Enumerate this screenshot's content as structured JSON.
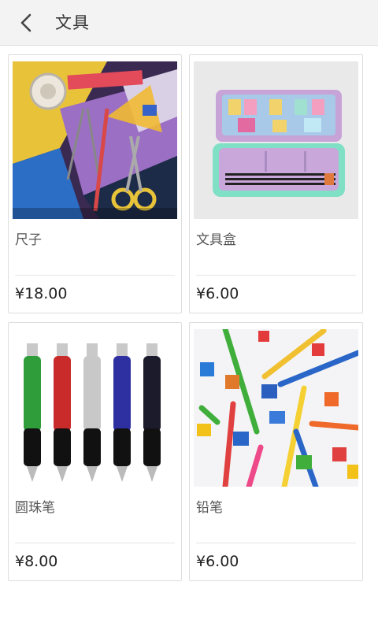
{
  "header": {
    "back_icon": "chevron-left-icon",
    "title": "文具"
  },
  "products": [
    {
      "name": "尺子",
      "price": "¥18.00",
      "image": "ruler-stationery-photo"
    },
    {
      "name": "文具盒",
      "price": "¥6.00",
      "image": "pencil-case-photo"
    },
    {
      "name": "圆珠笔",
      "price": "¥8.00",
      "image": "ballpoint-pens-photo"
    },
    {
      "name": "铅笔",
      "price": "¥6.00",
      "image": "colored-pencils-photo"
    }
  ],
  "colors": {
    "header_bg": "#f3f3f3",
    "card_border": "#dddddd",
    "text_dark": "#222222"
  }
}
